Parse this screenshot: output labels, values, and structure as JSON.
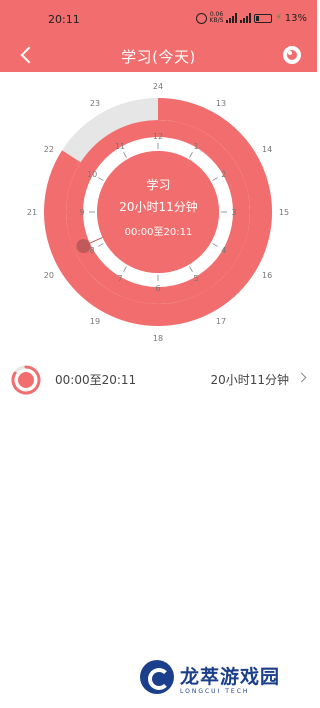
{
  "status_bar": {
    "time": "20:11",
    "net_speed_value": "0.06",
    "net_speed_unit": "KB/S",
    "battery_pct": "13%"
  },
  "nav": {
    "title": "学习(今天)",
    "back_icon": "chevron-left-icon",
    "settings_icon": "ring-icon"
  },
  "colors": {
    "accent": "#f26d6d",
    "track": "#e6e6e6",
    "handle": "#c05a5a",
    "white": "#ffffff",
    "watermark": "#1b3f8a"
  },
  "clock": {
    "outer_labels": [
      "24",
      "13",
      "14",
      "15",
      "16",
      "17",
      "18",
      "19",
      "20",
      "21",
      "22",
      "23"
    ],
    "inner_labels": [
      "12",
      "1",
      "2",
      "3",
      "4",
      "5",
      "6",
      "7",
      "8",
      "9",
      "10",
      "11"
    ],
    "center": {
      "name": "学习",
      "duration": "20小时11分钟",
      "range": "00:00至20:11"
    },
    "elapsed_hours": 20.18
  },
  "record": {
    "range": "00:00至20:11",
    "duration": "20小时11分钟",
    "progress": 0.84
  },
  "watermark": {
    "name": "龙萃游戏园",
    "sub": "LONGCUI TECH"
  }
}
